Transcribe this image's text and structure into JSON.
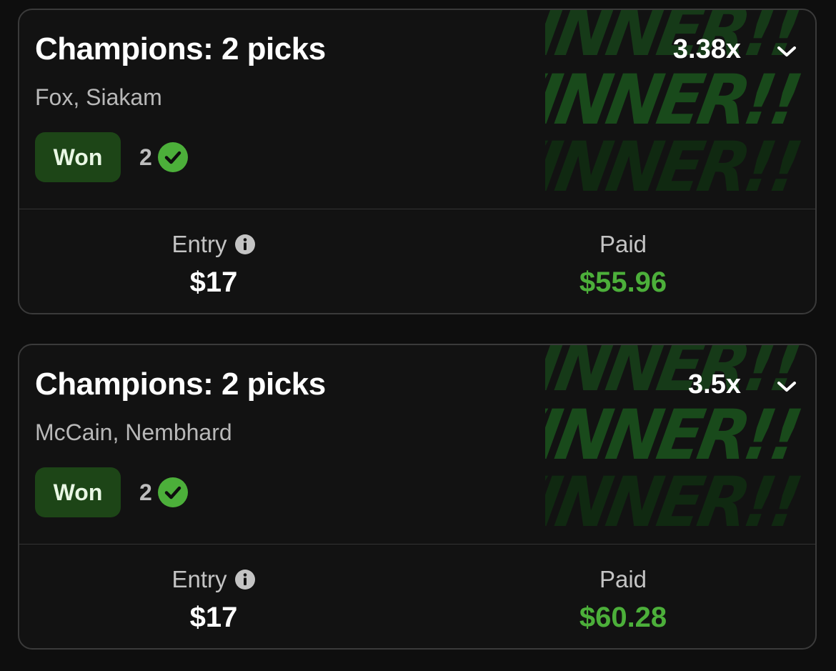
{
  "theme": {
    "background": "#0e0e0e",
    "card_border": "#3a3a3a",
    "won_badge_bg": "#1d4517",
    "success_green": "#4caf3a",
    "watermark_green": "#194a1b"
  },
  "icons": {
    "chevron": "chevron-down-icon",
    "check": "check-circle-icon",
    "info": "info-icon"
  },
  "cards": [
    {
      "title": "Champions: 2 picks",
      "multiplier": "3.38x",
      "players": "Fox, Siakam",
      "status": "Won",
      "correct_count": "2",
      "entry_label": "Entry",
      "entry_value": "$17",
      "paid_label": "Paid",
      "paid_value": "$55.96",
      "watermark": [
        "WINNER!!",
        "WINNER!!",
        "WINNER!!"
      ]
    },
    {
      "title": "Champions: 2 picks",
      "multiplier": "3.5x",
      "players": "McCain, Nembhard",
      "status": "Won",
      "correct_count": "2",
      "entry_label": "Entry",
      "entry_value": "$17",
      "paid_label": "Paid",
      "paid_value": "$60.28",
      "watermark": [
        "WINNER!!",
        "WINNER!!",
        "WINNER!!"
      ]
    }
  ]
}
